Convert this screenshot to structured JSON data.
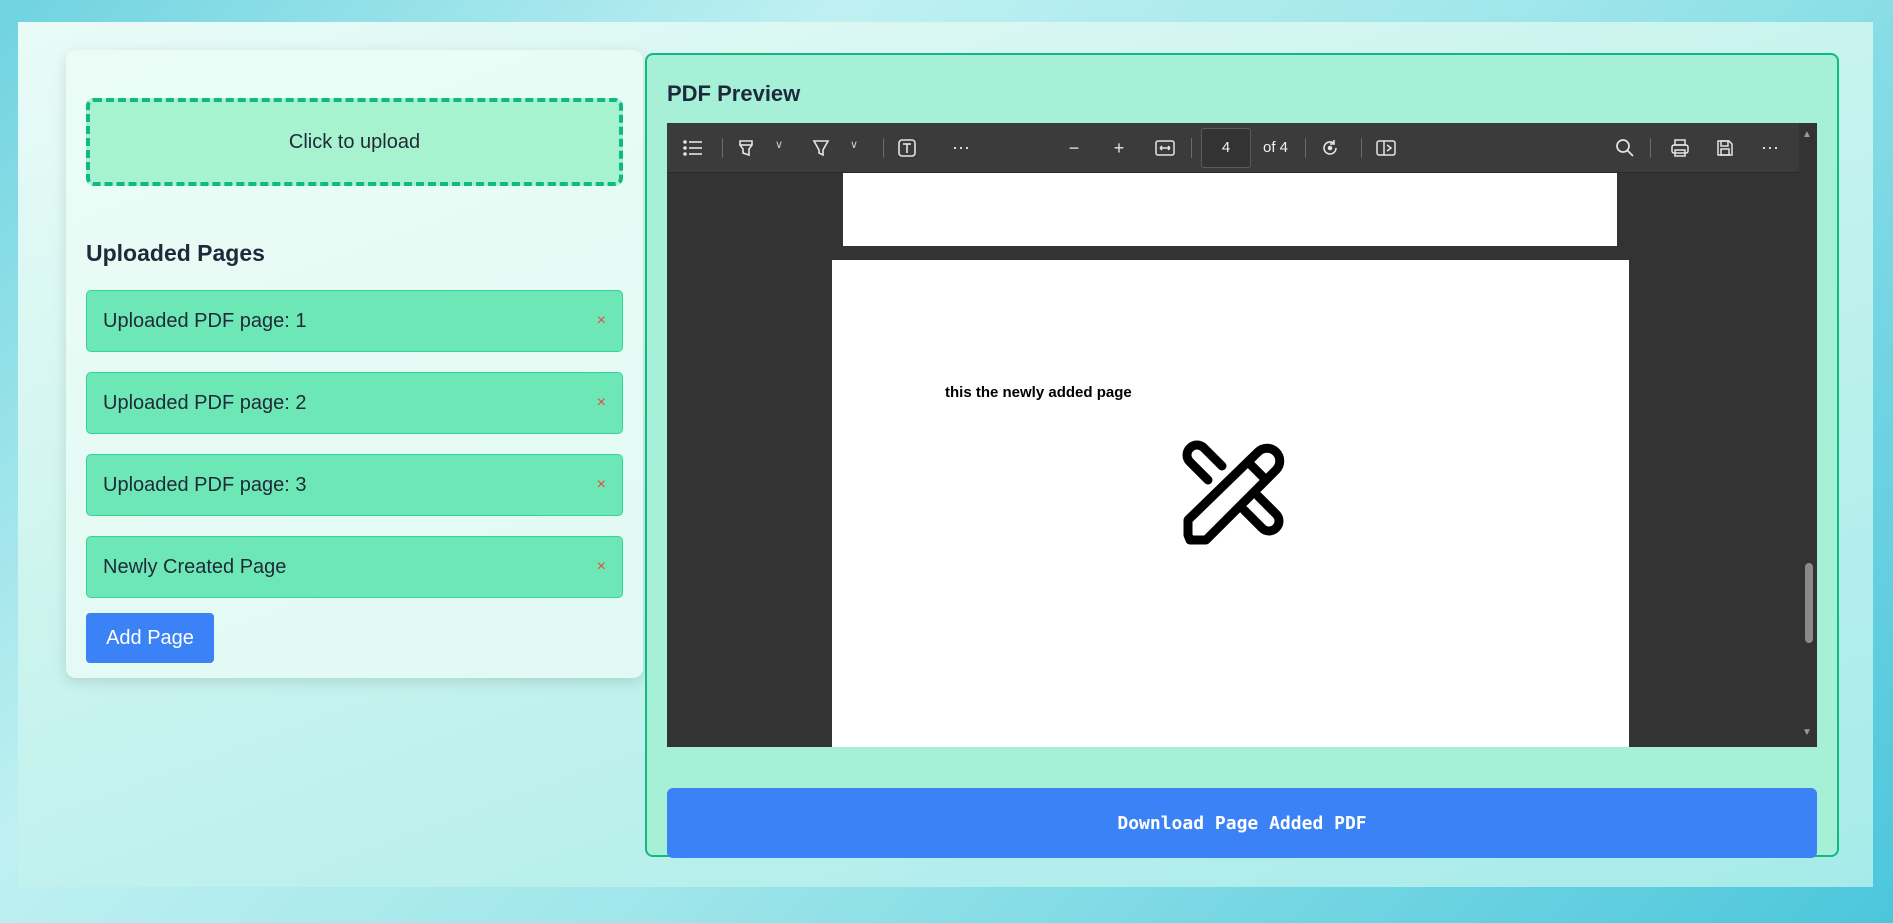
{
  "upload": {
    "label": "Click to upload"
  },
  "uploaded_pages": {
    "title": "Uploaded Pages",
    "items": [
      {
        "label": "Uploaded PDF page: 1",
        "remove": "×"
      },
      {
        "label": "Uploaded PDF page: 2",
        "remove": "×"
      },
      {
        "label": "Uploaded PDF page: 3",
        "remove": "×"
      },
      {
        "label": "Newly Created Page",
        "remove": "×"
      }
    ],
    "add_button": "Add Page"
  },
  "preview": {
    "title": "PDF Preview",
    "toolbar": {
      "icons": [
        "contents-icon",
        "highlight-icon",
        "draw-icon",
        "text-icon",
        "more-tools-icon",
        "zoom-out-icon",
        "zoom-in-icon",
        "fit-page-icon",
        "rotate-icon",
        "two-page-view-icon",
        "search-icon",
        "print-icon",
        "save-icon",
        "more-options-icon"
      ],
      "current_page": "4",
      "page_total_text": "of 4"
    },
    "page_content": {
      "text": "this the newly added page",
      "graphic": "pencil-ruler-icon"
    }
  },
  "download_button": "Download Page Added PDF",
  "colors": {
    "accent_blue": "#3b82f6",
    "green_border": "#10b981",
    "item_green": "#6ee7b7",
    "remove_red": "#ef4444"
  }
}
